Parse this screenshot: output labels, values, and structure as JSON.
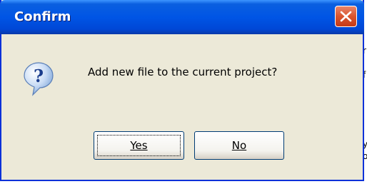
{
  "backdrop": {
    "fragments": [
      "r",
      "f",
      "y",
      "o"
    ]
  },
  "dialog": {
    "title": "Confirm",
    "message": "Add new file to the current project?",
    "icon": "question-icon",
    "close_icon": "close-icon",
    "buttons": {
      "yes_label": "Yes",
      "no_label": "No"
    }
  },
  "colors": {
    "titlebar": "#0055e5",
    "window_bg": "#ece9d8",
    "close_btn": "#d9542e"
  }
}
